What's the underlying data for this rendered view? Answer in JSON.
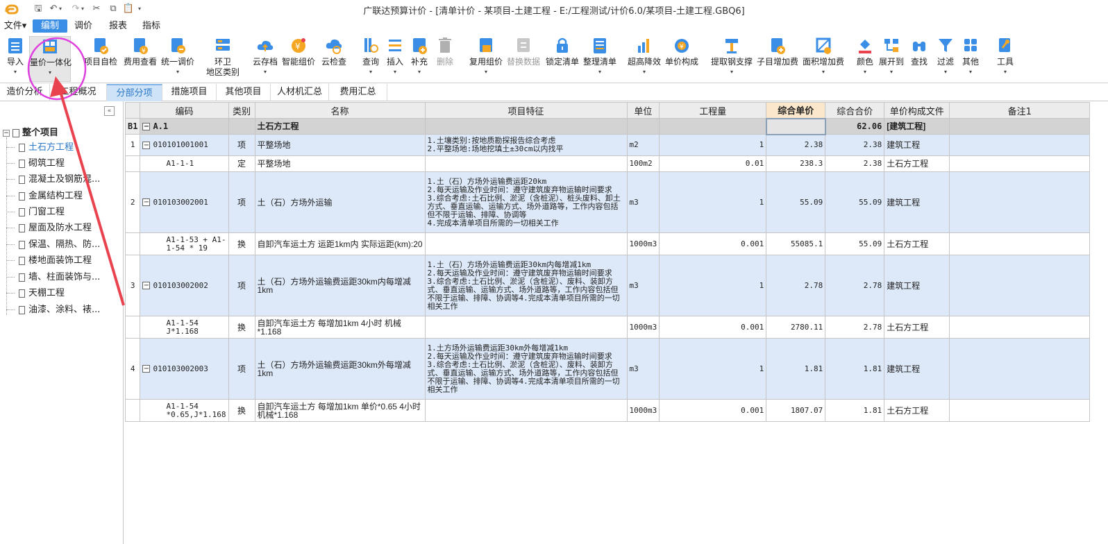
{
  "app": {
    "title": "广联达预算计价 - [清单计价 - 某项目-土建工程 - E:/工程测试/计价6.0/某项目-土建工程.GBQ6]"
  },
  "menu": [
    {
      "label": "文件▾"
    },
    {
      "label": "编制"
    },
    {
      "label": "调价"
    },
    {
      "label": "报表"
    },
    {
      "label": "指标"
    }
  ],
  "ribbon": [
    {
      "label": "导入",
      "dd": "▾"
    },
    {
      "label": "量价一体化",
      "dd": "▾"
    },
    {
      "label": "项目自检",
      "dd": ""
    },
    {
      "label": "费用查看",
      "dd": ""
    },
    {
      "label": "统一调价",
      "dd": "▾"
    },
    {
      "label": "环卫\n地区类别",
      "dd": ""
    },
    {
      "label": "云存档",
      "dd": "▾"
    },
    {
      "label": "智能组价",
      "dd": ""
    },
    {
      "label": "云检查",
      "dd": ""
    },
    {
      "label": "查询",
      "dd": "▾"
    },
    {
      "label": "插入",
      "dd": "▾"
    },
    {
      "label": "补充",
      "dd": "▾"
    },
    {
      "label": "删除",
      "dd": ""
    },
    {
      "label": "复用组价",
      "dd": "▾"
    },
    {
      "label": "替换数据",
      "dd": ""
    },
    {
      "label": "锁定清单",
      "dd": ""
    },
    {
      "label": "整理清单",
      "dd": "▾"
    },
    {
      "label": "超高降效",
      "dd": "▾"
    },
    {
      "label": "单价构成",
      "dd": ""
    },
    {
      "label": "提取钢支撑",
      "dd": "▾"
    },
    {
      "label": "子目增加费",
      "dd": ""
    },
    {
      "label": "面积增加费",
      "dd": "▾"
    },
    {
      "label": "颜色",
      "dd": "▾"
    },
    {
      "label": "展开到",
      "dd": "▾"
    },
    {
      "label": "查找",
      "dd": ""
    },
    {
      "label": "过滤",
      "dd": "▾"
    },
    {
      "label": "其他",
      "dd": "▾"
    },
    {
      "label": "工具",
      "dd": "▾"
    }
  ],
  "tabs": [
    {
      "label": "造价分析"
    },
    {
      "label": "工程概况"
    },
    {
      "label": "分部分项"
    },
    {
      "label": "措施项目"
    },
    {
      "label": "其他项目"
    },
    {
      "label": "人材机汇总"
    },
    {
      "label": "费用汇总"
    }
  ],
  "sidebar": {
    "root": "整个项目",
    "items": [
      "土石方工程",
      "砌筑工程",
      "混凝土及钢筋混...",
      "金属结构工程",
      "门窗工程",
      "屋面及防水工程",
      "保温、隔热、防...",
      "楼地面装饰工程",
      "墙、柱面装饰与...",
      "天棚工程",
      "油漆、涂料、裱..."
    ]
  },
  "table": {
    "headers": [
      "编码",
      "类别",
      "名称",
      "项目特征",
      "单位",
      "工程量",
      "综合单价",
      "综合合价",
      "单价构成文件",
      "备注1"
    ],
    "section": {
      "rowno": "B1",
      "code": "A.1",
      "name": "土石方工程",
      "total": "62.06",
      "file": "[建筑工程]"
    },
    "rows": [
      {
        "type": "qd",
        "rowno": "1",
        "code": "010101001001",
        "cat": "项",
        "name": "平整场地",
        "feat": "1.土壤类别:按地质勘探报告综合考虑\n2.平整场地:场地挖填土±30cm以内找平",
        "unit": "m2",
        "qty": "1",
        "price": "2.38",
        "total": "2.38",
        "file": "建筑工程"
      },
      {
        "type": "de",
        "rowno": "",
        "code": "A1-1-1",
        "cat": "定",
        "name": "平整场地",
        "feat": "",
        "unit": "100m2",
        "qty": "0.01",
        "price": "238.3",
        "total": "2.38",
        "file": "土石方工程"
      },
      {
        "type": "qd",
        "rowno": "2",
        "code": "010103002001",
        "cat": "项",
        "name": "土（石）方场外运输",
        "feat": "1.土（石）方场外运输费运距20km\n2.每天运输及作业时间：遵守建筑废弃物运输时间要求\n3.综合考虑:土石比例、淤泥（含桩泥）、桩头废料、卸土方式、垂直运输、运输方式、场外道路等，工作内容包括但不限于运输、排障、协调等\n4.完成本清单项目所需的一切相关工作",
        "unit": "m3",
        "qty": "1",
        "price": "55.09",
        "total": "55.09",
        "file": "建筑工程"
      },
      {
        "type": "de",
        "rowno": "",
        "code": "A1-1-53 + A1-1-54 * 19",
        "cat": "换",
        "name": "自卸汽车运土方 运距1km内  实际运距(km):20",
        "feat": "",
        "unit": "1000m3",
        "qty": "0.001",
        "price": "55085.1",
        "total": "55.09",
        "file": "土石方工程"
      },
      {
        "type": "qd",
        "rowno": "3",
        "code": "010103002002",
        "cat": "项",
        "name": "土（石）方场外运输费运距30km内每增减1km",
        "feat": "1.土（石）方场外运输费运距30km内每增减1km\n2.每天运输及作业时间：遵守建筑废弃物运输时间要求\n3.综合考虑:土石比例、淤泥（含桩泥）、废料、装卸方式、垂直运输、运输方式、场外道路等，工作内容包括但不限于运输、排障、协调等4.完成本清单项目所需的一切相关工作",
        "unit": "m3",
        "qty": "1",
        "price": "2.78",
        "total": "2.78",
        "file": "建筑工程"
      },
      {
        "type": "de",
        "rowno": "",
        "code": "A1-1-54 J*1.168",
        "cat": "换",
        "name": "自卸汽车运土方 每增加1km  4小时 机械*1.168",
        "feat": "",
        "unit": "1000m3",
        "qty": "0.001",
        "price": "2780.11",
        "total": "2.78",
        "file": "土石方工程"
      },
      {
        "type": "qd",
        "rowno": "4",
        "code": "010103002003",
        "cat": "项",
        "name": "土（石）方场外运输费运距30km外每增减1km",
        "feat": "1.土方场外运输费运距30km外每增减1km\n2.每天运输及作业时间：遵守建筑废弃物运输时间要求\n3.综合考虑:土石比例、淤泥（含桩泥）、废料、装卸方式、垂直运输、运输方式、场外道路等，工作内容包括但不限于运输、排障、协调等4.完成本清单项目所需的一切相关工作",
        "unit": "m3",
        "qty": "1",
        "price": "1.81",
        "total": "1.81",
        "file": "建筑工程"
      },
      {
        "type": "de",
        "rowno": "",
        "code": "A1-1-54 *0.65,J*1.168",
        "cat": "换",
        "name": "自卸汽车运土方 每增加1km  单价*0.65  4小时 机械*1.168",
        "feat": "",
        "unit": "1000m3",
        "qty": "0.001",
        "price": "1807.07",
        "total": "1.81",
        "file": "土石方工程"
      }
    ]
  },
  "colors": {
    "accent": "#3a8ee6",
    "annotation": "#e8434f",
    "highlight_ring": "#e040e0"
  }
}
